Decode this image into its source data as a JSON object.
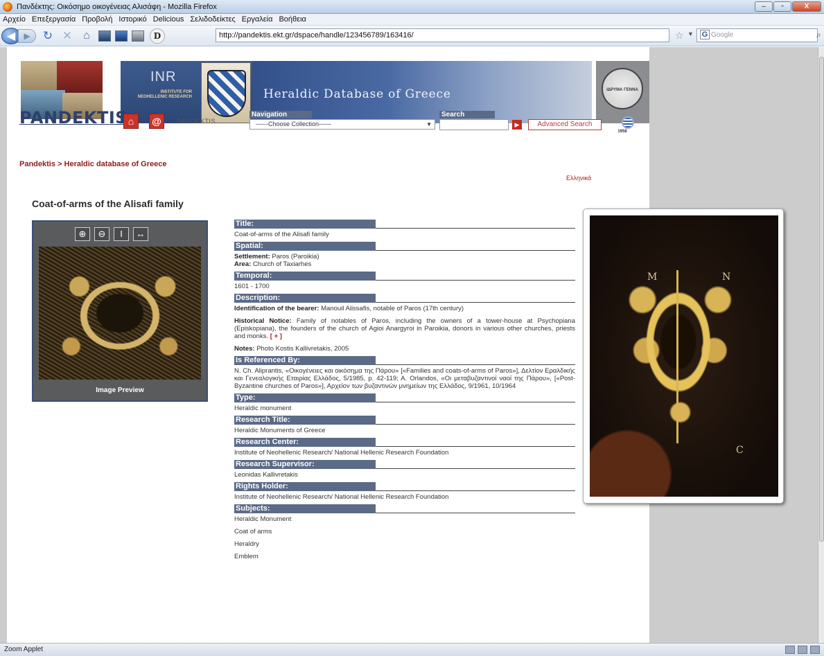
{
  "window": {
    "title": "Πανδέκτης: Οικόσημο οικογένειας Αλισάφη - Mozilla Firefox",
    "buttons": [
      "–",
      "▫",
      "X"
    ]
  },
  "menu": [
    "Αρχείο",
    "Επεξεργασία",
    "Προβολή",
    "Ιστορικό",
    "Delicious",
    "Σελιδοδείκτες",
    "Εργαλεία",
    "Βοήθεια"
  ],
  "toolbar": {
    "url": "http://pandektis.ekt.gr/dspace/handle/123456789/163416/",
    "search_placeholder": "Google",
    "search_engine_letter": "G"
  },
  "header": {
    "logo_text": "PANDEKTIS",
    "inr_big": "INR",
    "inr_small": "INSTITUTE FOR NEOHELLENIC RESEARCH",
    "banner_title": "Heraldic Database of Greece",
    "seal_text": "ΙΔΡΥΜΑ ΓΕΝΝΑ 1958",
    "pandektis_link": "PANDEKTIS",
    "navigation_label": "Navigation",
    "navigation_select": "------Choose Collection------",
    "search_label": "Search",
    "advanced_search": "Advanced Search"
  },
  "breadcrumb": "Pandektis   > Heraldic database of Greece",
  "language_link": "Ελληνικά",
  "page_title": "Coat-of-arms of the Alisafi family",
  "preview": {
    "caption": "Image Preview",
    "tools": [
      "⊕",
      "⊖",
      "I",
      "↔"
    ]
  },
  "metadata": {
    "title_h": "Title:",
    "title_v": "Coat-of-arms of the Alisafi family",
    "spatial_h": "Spatial:",
    "settlement_k": "Settlement:",
    "settlement_v": "Paros (Paroikia)",
    "area_k": "Area:",
    "area_v": "Church of Taxiarhes",
    "temporal_h": "Temporal:",
    "temporal_v": "1601 - 1700",
    "description_h": "Description:",
    "ident_k": "Identification of the bearer:",
    "ident_v": "Manouil Alissafis, notable of Paros (17th century)",
    "hist_k": "Historical Notice:",
    "hist_v": "Family of notables of Paros, including the owners of a tower-house at Psychopiana (Episkopiana), the founders of the church of Agioi Anargyroi in Paroikia, donors in various other churches, priests and monks.",
    "hist_more": "[ + ]",
    "notes_k": "Notes:",
    "notes_v": "Photo Kostis Kallivretakis, 2005",
    "ref_h": "Is Referenced By:",
    "ref_v": "N. Ch. Aliprantis, «Οικογένειες και οικόσημα της Πάρου» [«Families and coats-of-arms of Paros»], Δελτίον Εραλδικής και Γενεαλογικής Εταιρίας Ελλάδος, 5/1985, p. 42-119; A. Orlandos, «Οι μεταβυζαντινοί ναοί της Πάρου», [«Post-Byzantine churches of Paros»], Αρχείον των βυζαντινών μνημείων της Ελλάδος, 9/1961, 10/1964",
    "type_h": "Type:",
    "type_v": "Heraldic monument",
    "rtitle_h": "Research Title:",
    "rtitle_v": "Heraldic Monuments of Greece",
    "rcenter_h": "Research Center:",
    "rcenter_v": "Institute of Neohellenic Research/ National Hellenic Research Foundation",
    "rsup_h": "Research Supervisor:",
    "rsup_v": "Leonidas Kallivretakis",
    "rights_h": "Rights Holder:",
    "rights_v": "Institute of Neohellenic Research/ National Hellenic Research Foundation",
    "subjects_h": "Subjects:",
    "subjects": [
      "Heraldic Monument",
      "Coat of arms",
      "Heraldry",
      "Emblem"
    ]
  },
  "big_image_letters": [
    "M",
    "N",
    "C"
  ],
  "status": "Zoom Applet"
}
